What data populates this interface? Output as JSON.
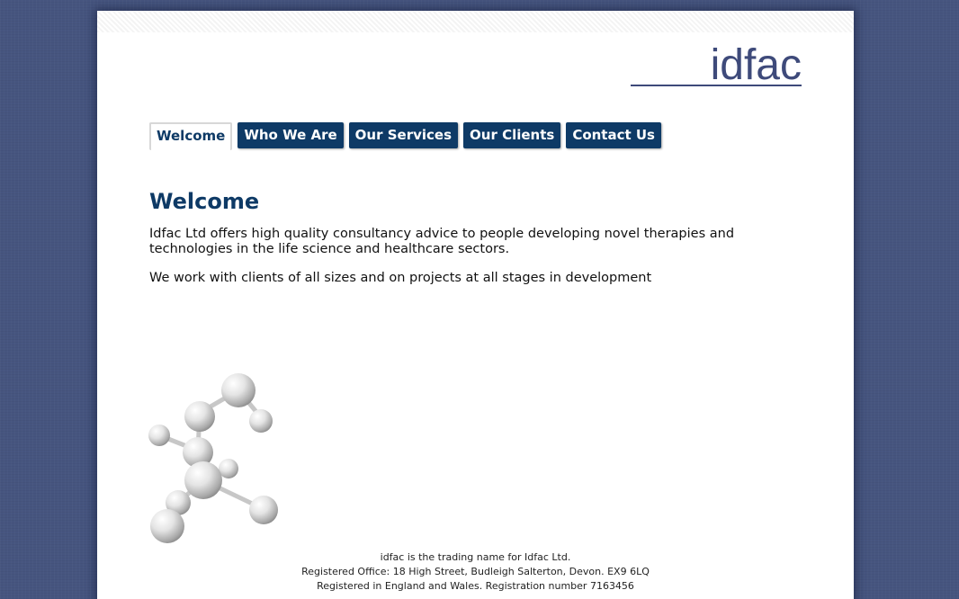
{
  "logo": {
    "text": "idfac"
  },
  "nav": {
    "tabs": [
      {
        "label": "Welcome",
        "active": true
      },
      {
        "label": "Who We Are",
        "active": false
      },
      {
        "label": "Our Services",
        "active": false
      },
      {
        "label": "Our Clients",
        "active": false
      },
      {
        "label": "Contact Us",
        "active": false
      }
    ]
  },
  "main": {
    "title": "Welcome",
    "paragraphs": [
      "Idfac Ltd offers high quality consultancy advice to people developing novel therapies and technologies in the life science and healthcare sectors.",
      "We work with clients of all sizes and on projects at all stages in development"
    ]
  },
  "footer": {
    "lines": [
      "idfac is the trading name for Idfac Ltd.",
      "Registered Office: 18 High Street, Budleigh Salterton, Devon. EX9 6LQ",
      "Registered in England and Wales. Registration number 7163456"
    ]
  },
  "colors": {
    "background": "#46557f",
    "brand_navy": "#0e3a66",
    "logo": "#3e4a7a"
  }
}
